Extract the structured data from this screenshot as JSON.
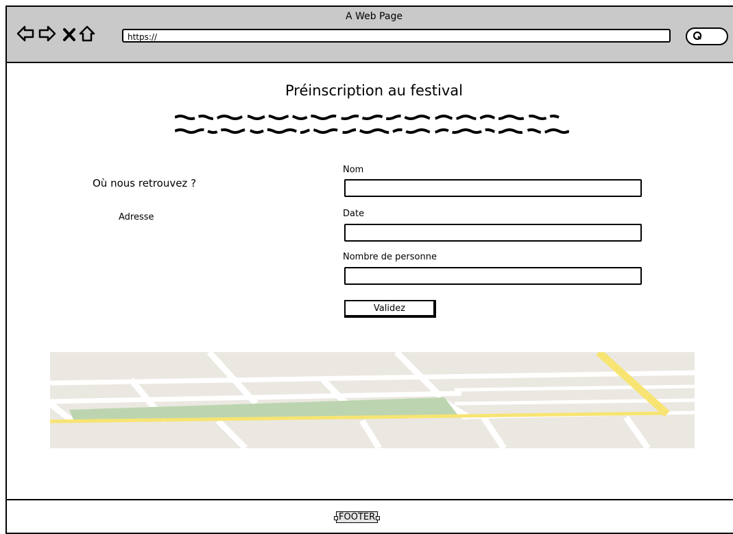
{
  "browser": {
    "window_title": "A Web Page",
    "url": "https://",
    "icons": [
      "back-arrow-icon",
      "forward-arrow-icon",
      "close-icon",
      "home-icon",
      "search-icon"
    ]
  },
  "page": {
    "title": "Préinscription au festival",
    "where_heading": "Où nous retrouvez ?",
    "address_label": "Adresse"
  },
  "form": {
    "fields": [
      {
        "label": "Nom",
        "value": ""
      },
      {
        "label": "Date",
        "value": ""
      },
      {
        "label": "Nombre de personne",
        "value": ""
      }
    ],
    "submit_label": "Validez"
  },
  "footer": {
    "label": "FOOTER"
  },
  "colors": {
    "chrome": "#c9c9c9",
    "map_bg": "#ebe8e1",
    "map_road": "#ffffff",
    "map_park": "#bcd5b0",
    "map_main_road": "#f7e472"
  }
}
